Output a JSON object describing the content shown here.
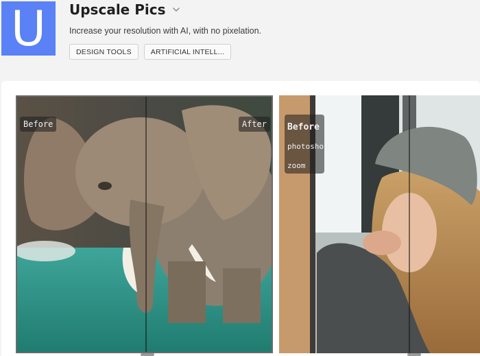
{
  "app": {
    "logo_letter": "U",
    "title": "Upscale Pics",
    "description": "Increase your resolution with AI, with no pixelation.",
    "tags": [
      "DESIGN TOOLS",
      "ARTIFICIAL INTELL..."
    ]
  },
  "colors": {
    "logo_bg": "#5a81f6",
    "page_bg": "#f3f3f3",
    "panel_bg": "#ffffff"
  },
  "icons": {
    "title_dropdown": "chevron-down-icon"
  },
  "screenshots": [
    {
      "subject": "elephant-in-water",
      "labels": {
        "before": "Before",
        "after": "After"
      }
    },
    {
      "subject": "woman-in-beanie",
      "labels": {
        "line1": "Before",
        "line2": "photoshop",
        "line3": "zoom"
      }
    }
  ]
}
